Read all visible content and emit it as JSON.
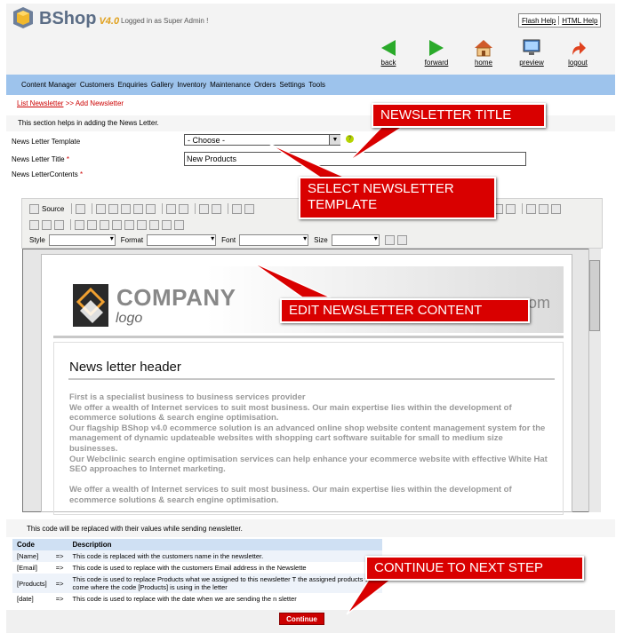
{
  "header": {
    "brand": "BShop",
    "version": "V4.0",
    "logged_in": "Logged in as Super Admin !",
    "flash_help": "Flash Help",
    "html_help": "HTML Help",
    "nav": [
      {
        "label": "back",
        "icon": "back-arrow-icon",
        "color": "#2aaa2a"
      },
      {
        "label": "forward",
        "icon": "forward-arrow-icon",
        "color": "#2aaa2a"
      },
      {
        "label": "home",
        "icon": "home-icon"
      },
      {
        "label": "preview",
        "icon": "monitor-icon"
      },
      {
        "label": "logout",
        "icon": "logout-arrow-icon",
        "color": "#e0431f"
      }
    ]
  },
  "menu": [
    "Content Manager",
    "Customers",
    "Enquiries",
    "Gallery",
    "Inventory",
    "Maintenance",
    "Orders",
    "Settings",
    "Tools"
  ],
  "breadcrumb": {
    "link": "List Newsletter",
    "sep": " >> ",
    "current": "Add Newsletter"
  },
  "help_text": "This section helps in adding the News Letter.",
  "form": {
    "template_label": "News Letter Template",
    "template_value": "- Choose -",
    "title_label": "News Letter Title",
    "title_value": "New Products",
    "contents_label": "News LetterContents",
    "required_mark": "*"
  },
  "editor": {
    "source_label": "Source",
    "style_label": "Style",
    "format_label": "Format",
    "font_label": "Font",
    "size_label": "Size"
  },
  "newsletter": {
    "company": "COMPANY",
    "logo_word": "logo",
    "domain_end": "om",
    "header": "News letter header",
    "paragraphs": [
      "First is a specialist business to business services provider",
      "We offer a wealth of Internet services to suit most business. Our main expertise lies within the development of ecommerce solutions & search engine optimisation.",
      "Our flagship BShop v4.0 ecommerce solution is an advanced online shop website content management system for the management of dynamic updateable websites with shopping cart software suitable for small to medium size businesses.",
      "Our Webclinic search engine optimisation services can help enhance your ecommerce website with effective White Hat SEO approaches to Internet marketing."
    ],
    "paragraph_after_gap": "We offer a wealth of Internet services to suit most business. Our main expertise lies within the development of ecommerce solutions & search engine optimisation."
  },
  "codes": {
    "note": "This code will be replaced with their values while sending newsletter.",
    "headers": [
      "Code",
      "",
      "Description"
    ],
    "rows": [
      [
        "[Name]",
        "=>",
        "This code is replaced with the customers name in the newsletter."
      ],
      [
        "[Email]",
        "=>",
        "This code is used to replace with the customers Email address in the Newslette"
      ],
      [
        "[Products]",
        "=>",
        "This code is used to replace Products what we assigned to this newsletter T the assigned products will come where the code [Products] is using in the letter"
      ],
      [
        "[date]",
        "=>",
        "This code is used to replace with the date when we are sending the n sletter"
      ]
    ]
  },
  "continue_label": "Continue",
  "callouts": {
    "title": "NEWSLETTER TITLE",
    "template": "SELECT NEWSLETTER TEMPLATE",
    "content": "EDIT NEWSLETTER CONTENT",
    "continue": "CONTINUE TO NEXT STEP"
  },
  "colors": {
    "callout": "#d90000",
    "menu": "#9dc3ec",
    "link": "#cc0000"
  }
}
